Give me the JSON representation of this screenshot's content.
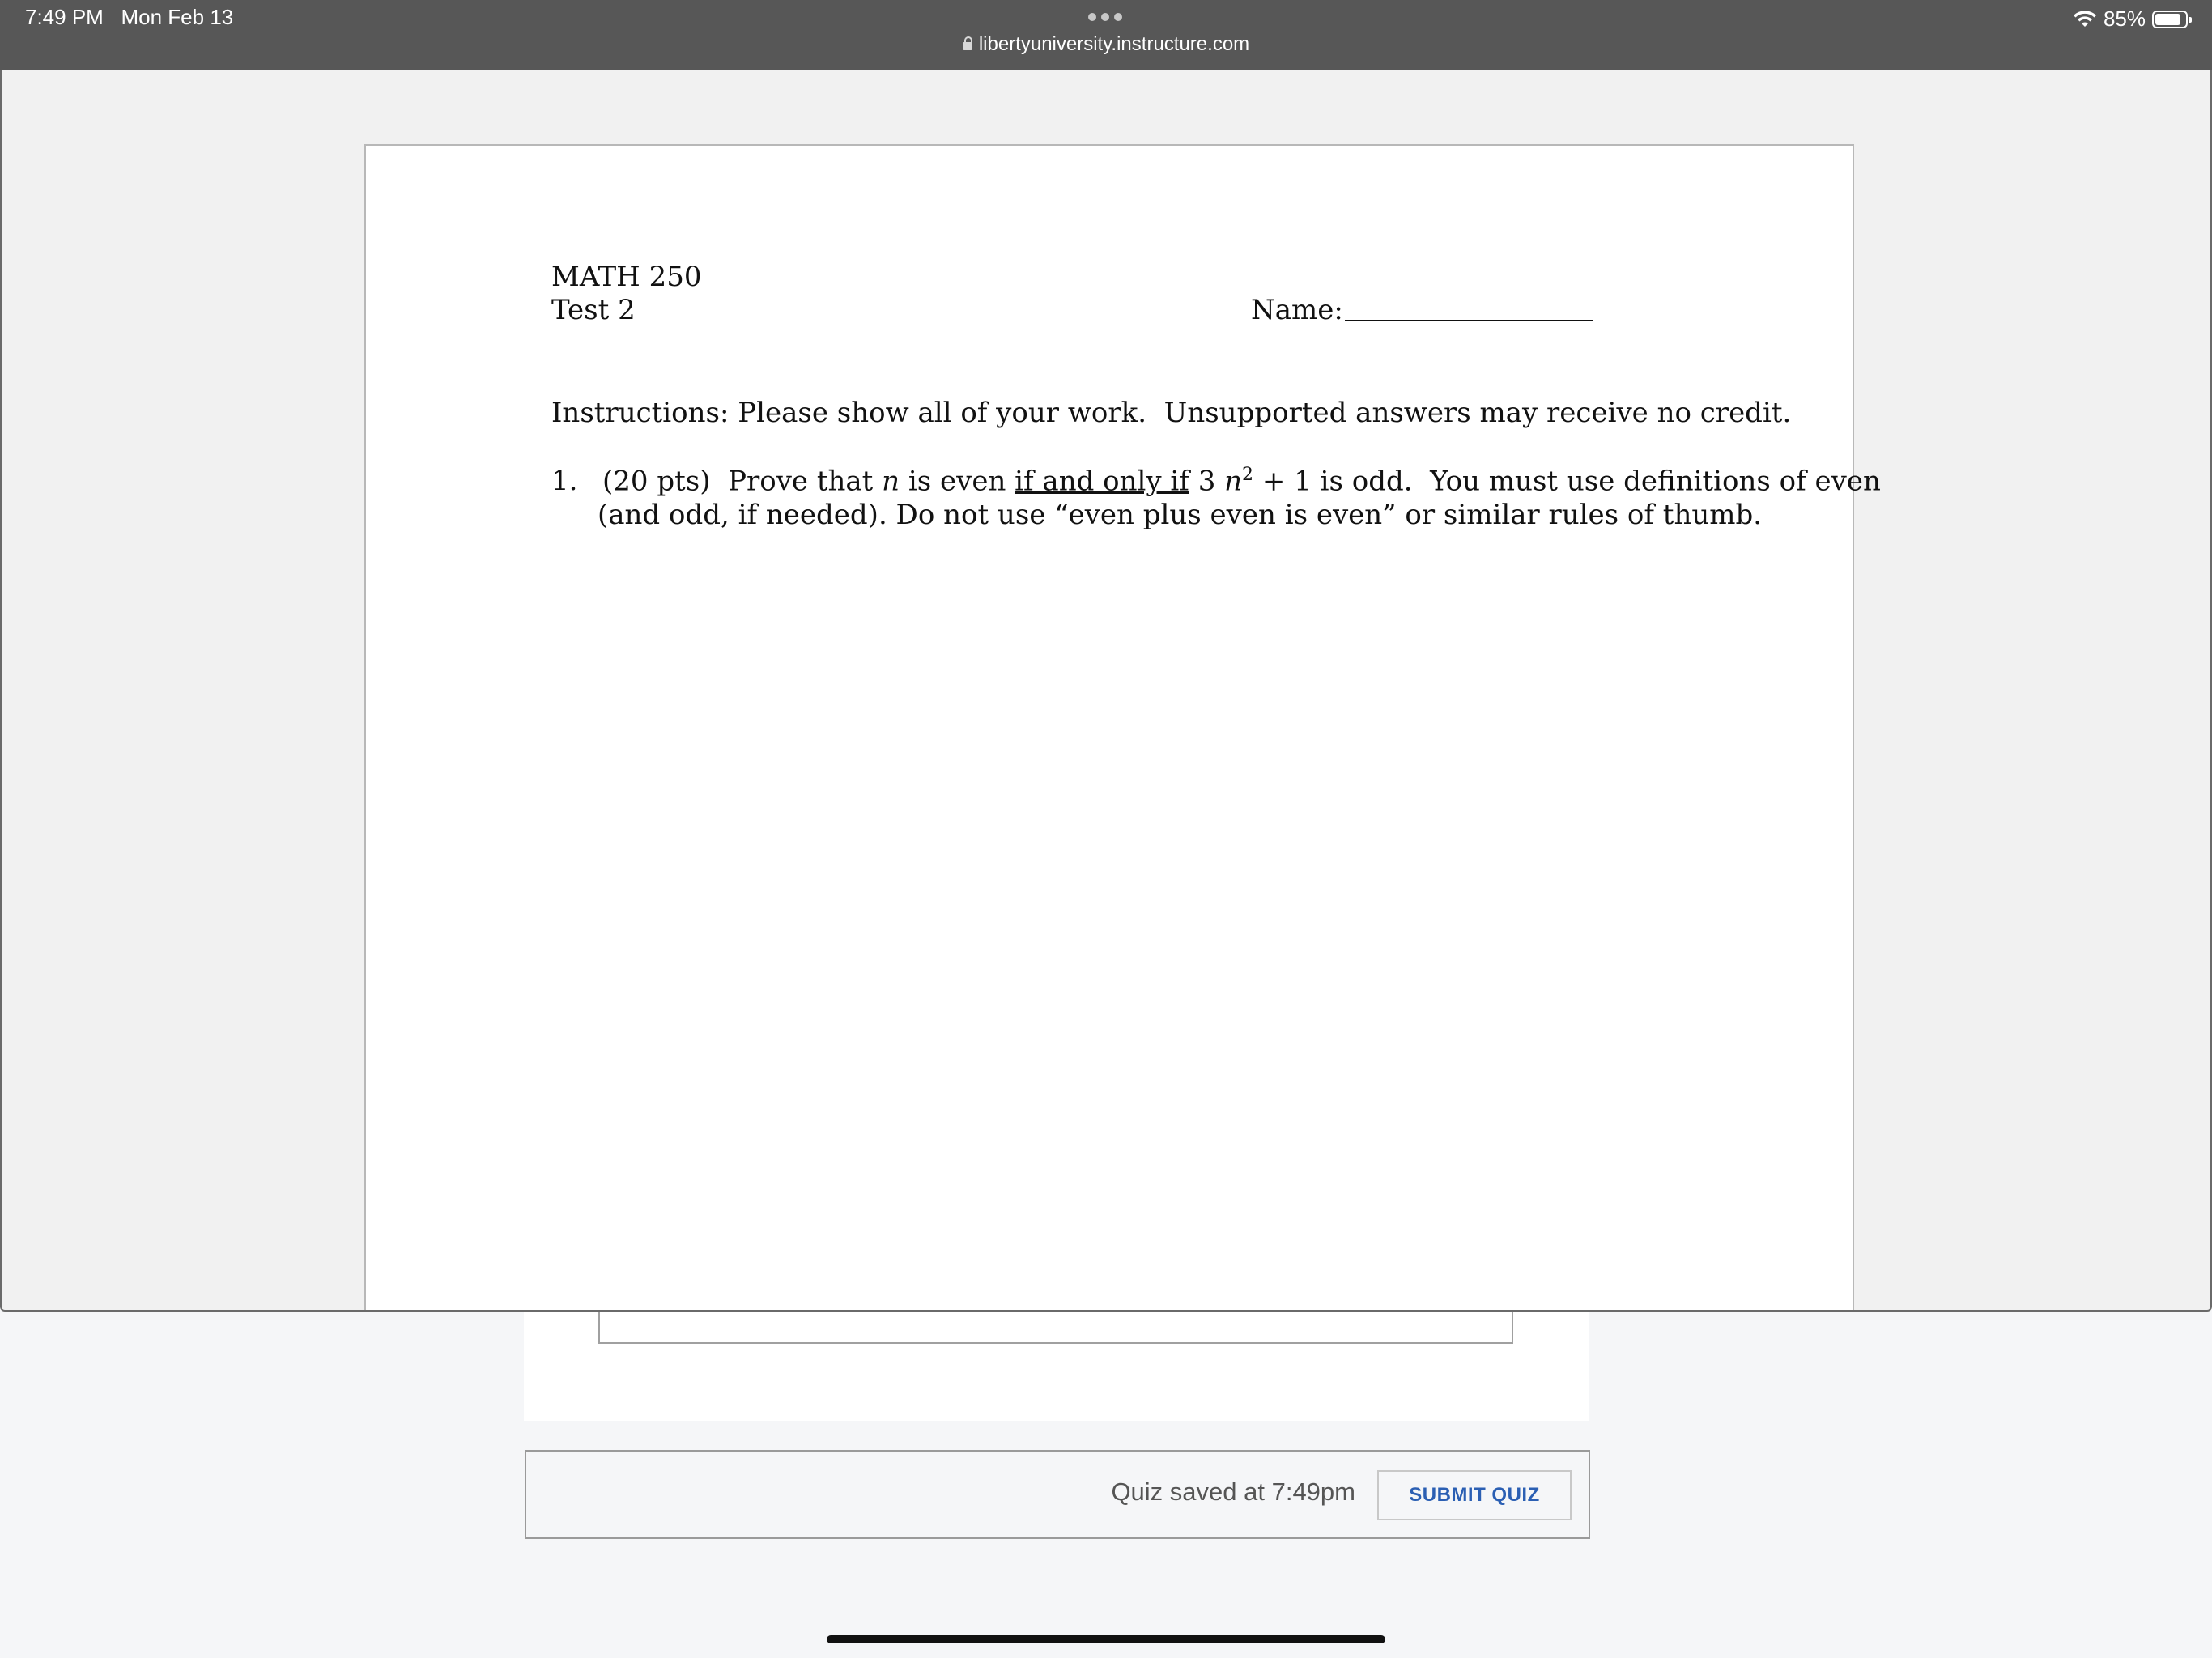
{
  "status_bar": {
    "time": "7:49 PM",
    "date": "Mon Feb 13",
    "url": "libertyuniversity.instructure.com",
    "battery_percent": "85%",
    "battery_level": 0.85,
    "icons": [
      "more-dots-icon",
      "lock-icon",
      "wifi-icon",
      "battery-icon"
    ]
  },
  "document": {
    "course": "MATH 250",
    "test": "Test 2",
    "name_label": "Name:",
    "instructions": "Instructions: Please show all of your work.  Unsupported answers may receive no credit.",
    "question1": {
      "number": "1.",
      "points": "(20 pts)",
      "prefix": "Prove that ",
      "var_n": "n",
      "is_even": " is even ",
      "iff": "if and only if",
      "expr_pre": " 3 ",
      "exp": "2",
      "expr_post": " + 1 is odd.  You must use definitions of even",
      "line2": "(and odd, if needed). Do not use “even plus even is even” or similar rules of thumb."
    }
  },
  "quiz": {
    "saved_text": "Quiz saved at 7:49pm",
    "submit_label": "SUBMIT QUIZ",
    "submit_color": "#2b5fb3"
  }
}
